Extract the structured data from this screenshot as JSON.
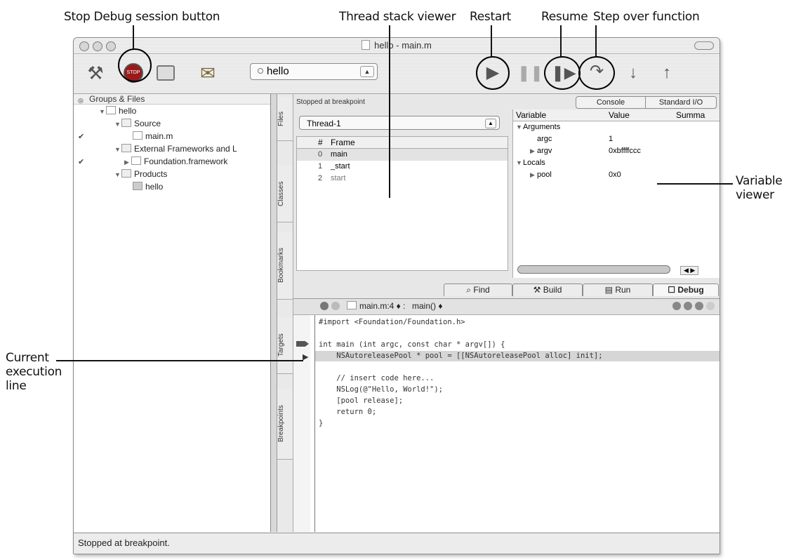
{
  "callouts": {
    "stop_debug": "Stop Debug session button",
    "thread_stack": "Thread stack viewer",
    "restart": "Restart",
    "resume": "Resume",
    "step_over": "Step over function",
    "variable_viewer_1": "Variable",
    "variable_viewer_2": "viewer",
    "current_exec_1": "Current",
    "current_exec_2": "execution",
    "current_exec_3": "line"
  },
  "window": {
    "title": "hello - main.m"
  },
  "toolbar": {
    "target": "hello",
    "icons": [
      "hammer-icon",
      "stop-icon",
      "build-run-icon",
      "clean-icon",
      "restart-icon",
      "pause-icon",
      "resume-icon",
      "step-over-icon",
      "step-into-icon",
      "step-out-icon"
    ]
  },
  "sidebar": {
    "header": "Groups & Files",
    "items": [
      {
        "label": "hello"
      },
      {
        "label": "Source"
      },
      {
        "label": "main.m"
      },
      {
        "label": "External Frameworks and L"
      },
      {
        "label": "Foundation.framework"
      },
      {
        "label": "Products"
      },
      {
        "label": "hello"
      }
    ]
  },
  "vtabs": [
    "Files",
    "Classes",
    "Bookmarks",
    "Targets",
    "Breakpoints"
  ],
  "debugger": {
    "status": "Stopped at breakpoint",
    "console_btn": "Console",
    "stdio_btn": "Standard I/O",
    "thread": "Thread-1",
    "frames_header": {
      "num": "#",
      "frame": "Frame"
    },
    "frames": [
      {
        "num": "0",
        "fn": "main"
      },
      {
        "num": "1",
        "fn": "_start"
      },
      {
        "num": "2",
        "fn": "start"
      }
    ],
    "vars_header": {
      "variable": "Variable",
      "value": "Value",
      "summary": "Summa"
    },
    "vars": [
      {
        "name": "Arguments",
        "value": ""
      },
      {
        "name": "argc",
        "value": "1"
      },
      {
        "name": "argv",
        "value": "0xbffffccc"
      },
      {
        "name": "Locals",
        "value": ""
      },
      {
        "name": "pool",
        "value": "0x0"
      }
    ]
  },
  "bottom_tabs": {
    "find": "Find",
    "build": "Build",
    "run": "Run",
    "debug": "Debug"
  },
  "editor": {
    "file": "main.m:4 ♦ :",
    "function": "main() ♦",
    "lines": [
      "#import <Foundation/Foundation.h>",
      "",
      "int main (int argc, const char * argv[]) {",
      "    NSAutoreleasePool * pool = [[NSAutoreleasePool alloc] init];",
      "",
      "    // insert code here...",
      "    NSLog(@\"Hello, World!\");",
      "    [pool release];",
      "    return 0;",
      "}"
    ]
  },
  "statusbar": {
    "text": "Stopped at breakpoint."
  },
  "colors": {
    "highlight": "#d6d6d6",
    "window_bg": "#ececec"
  }
}
